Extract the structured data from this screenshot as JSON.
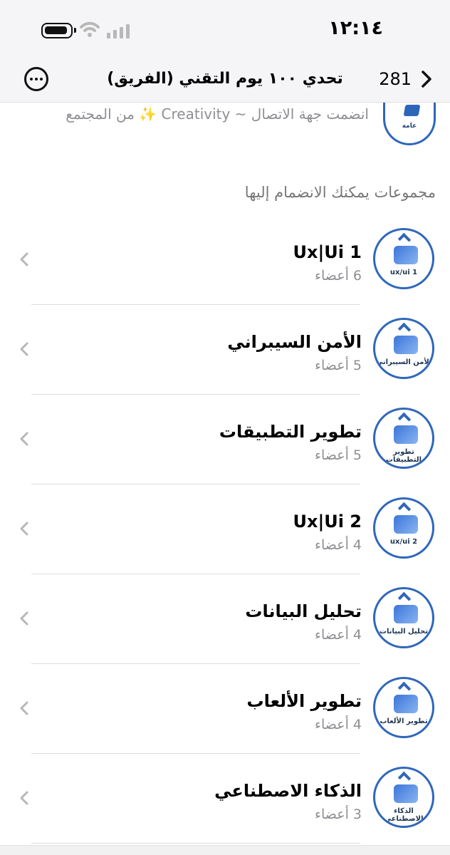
{
  "status_bar": {
    "time": "١٢:١٤"
  },
  "nav": {
    "title": "تحدي ١٠٠ يوم التقني (الفريق)",
    "count": "281"
  },
  "notice": {
    "avatar_label": "عامة",
    "text": "انضمت جهة الاتصال ~ Creativity ✨ من المجتمع"
  },
  "section_title": "مجموعات يمكنك الانضمام إليها",
  "groups": [
    {
      "name": "Ux|Ui 1",
      "members": "6 أعضاء",
      "caption": "ux/ui 1"
    },
    {
      "name": "الأمن السيبراني",
      "members": "5 أعضاء",
      "caption": "الأمن السيبراني"
    },
    {
      "name": "تطوير التطبيقات",
      "members": "5 أعضاء",
      "caption": "تطوير التطبيقات"
    },
    {
      "name": "Ux|Ui 2",
      "members": "4 أعضاء",
      "caption": "ux/ui 2"
    },
    {
      "name": "تحليل البيانات",
      "members": "4 أعضاء",
      "caption": "تحليل البيانات"
    },
    {
      "name": "تطوير الألعاب",
      "members": "4 أعضاء",
      "caption": "تطوير الألعاب"
    },
    {
      "name": "الذكاء الاصطناعي",
      "members": "3 أعضاء",
      "caption": "الذكاء الاصطناعي"
    }
  ],
  "colors": {
    "accent": "#2f67bb",
    "secondary_text": "#8e8e93",
    "header_bg": "#f5f5f7"
  },
  "icons": [
    "battery-icon",
    "wifi-icon",
    "signal-icon",
    "more-icon",
    "back-chevron-icon",
    "row-chevron-icon"
  ]
}
